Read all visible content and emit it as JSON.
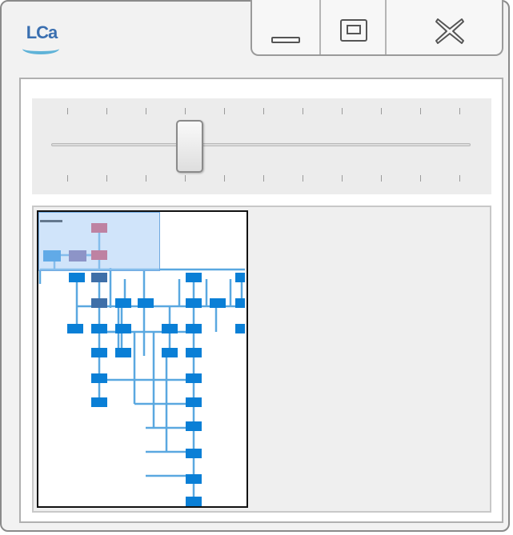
{
  "window": {
    "app_logo_text": "LCa",
    "logo_icon": "lca-logo-icon",
    "controls": {
      "minimize_icon": "minimize-icon",
      "maximize_icon": "maximize-icon",
      "close_icon": "close-icon"
    }
  },
  "zoom_slider": {
    "level": 0.33,
    "tick_count": 11
  },
  "overview": {
    "viewport": "visible-region-rectangle",
    "colors": {
      "root_node": "#d7263d",
      "node": "#0a7fd6",
      "node_dark": "#3f6fa8",
      "node_purple": "#6a4f8f",
      "edge": "#5aa8e0",
      "viewport_fill": "#b4d4f6"
    }
  }
}
